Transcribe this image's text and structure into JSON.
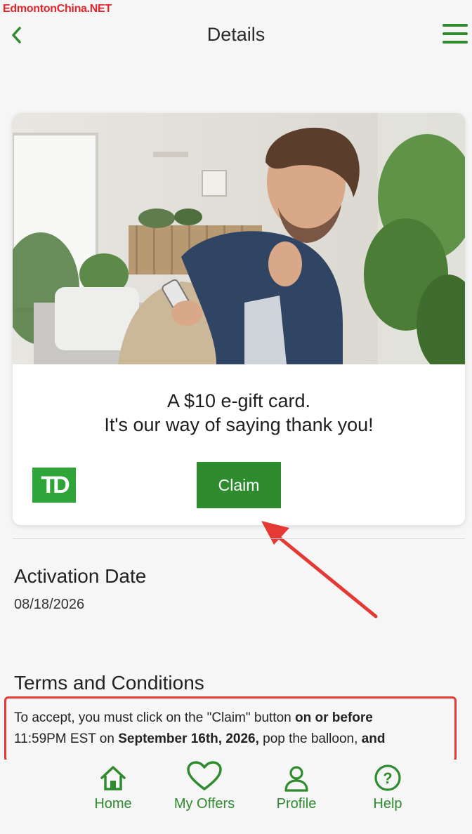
{
  "watermark": "EdmontonChina.NET",
  "header": {
    "title": "Details"
  },
  "offer": {
    "headline_line1": "A $10 e-gift card.",
    "headline_line2": "It's our way of saying thank you!",
    "logo_text": "TD",
    "claim_label": "Claim"
  },
  "activation": {
    "heading": "Activation Date",
    "date": "08/18/2026"
  },
  "terms": {
    "heading": "Terms and Conditions",
    "t1": "To accept, you must click on the \"Claim\" button ",
    "b1": "on or before",
    "t2": "11:59PM EST on ",
    "b2": "September 16th, 2026,",
    "t3": " pop the balloon, ",
    "b3": "and"
  },
  "tabs": [
    {
      "label": "Home",
      "icon": "home-icon"
    },
    {
      "label": "My Offers",
      "icon": "heart-icon"
    },
    {
      "label": "Profile",
      "icon": "person-icon"
    },
    {
      "label": "Help",
      "icon": "help-icon"
    }
  ],
  "colors": {
    "brand_green": "#2e8b2e",
    "annotation_red": "#e53935"
  }
}
